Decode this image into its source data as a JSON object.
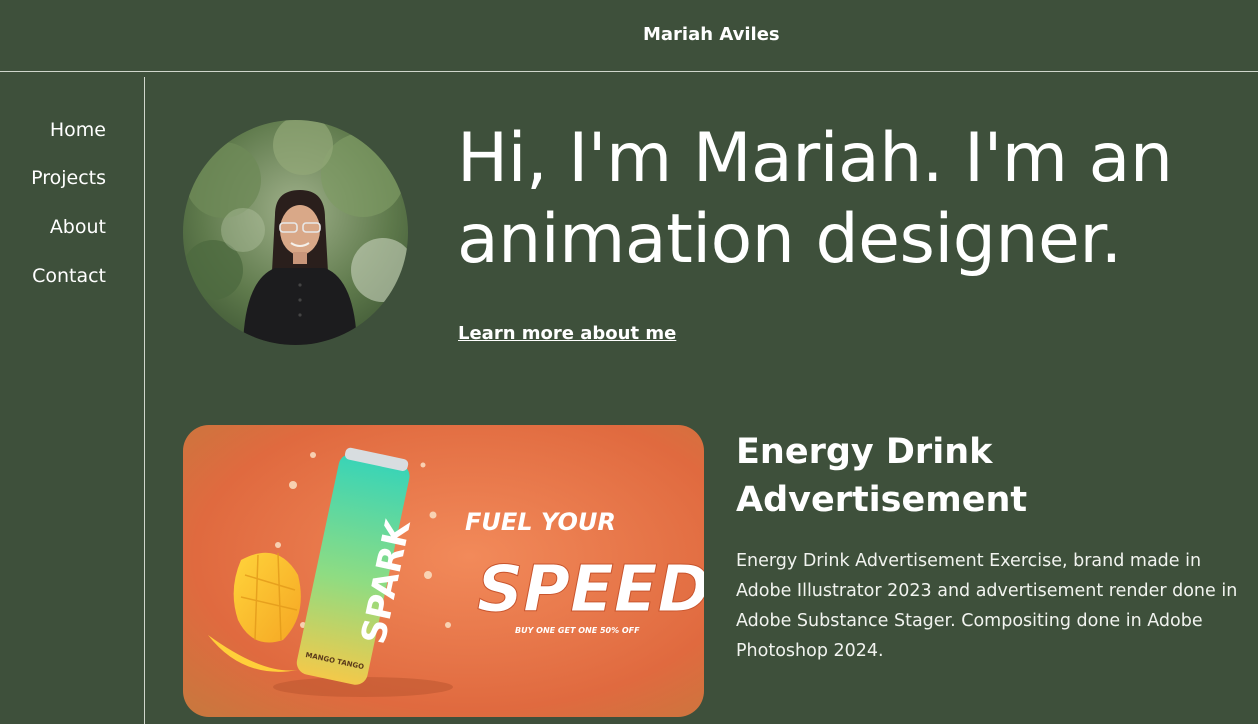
{
  "header": {
    "site_name": "Mariah Aviles"
  },
  "nav": {
    "items": [
      {
        "label": "Home"
      },
      {
        "label": "Projects"
      },
      {
        "label": "About"
      },
      {
        "label": "Contact"
      }
    ]
  },
  "hero": {
    "title": "Hi, I'm Mariah. I'm an animation designer.",
    "link_label": "Learn more about me",
    "avatar_icon": "profile-photo"
  },
  "project": {
    "title": "Energy Drink Advertisement",
    "description": "Energy Drink Advertisement Exercise, brand made in Adobe Illustrator 2023 and advertisement render done in Adobe Substance Stager. Compositing done in Adobe Photoshop 2024.",
    "image": {
      "brand": "SPARK",
      "headline_small": "FUEL YOUR",
      "headline_big": "SPEED.",
      "offer": "BUY ONE GET ONE  50% OFF",
      "flavor": "MANGO TANGO"
    }
  },
  "colors": {
    "background": "#3e503b",
    "text": "#ffffff",
    "divider": "#cfd6cc",
    "ad_orange": "#e8744a"
  }
}
